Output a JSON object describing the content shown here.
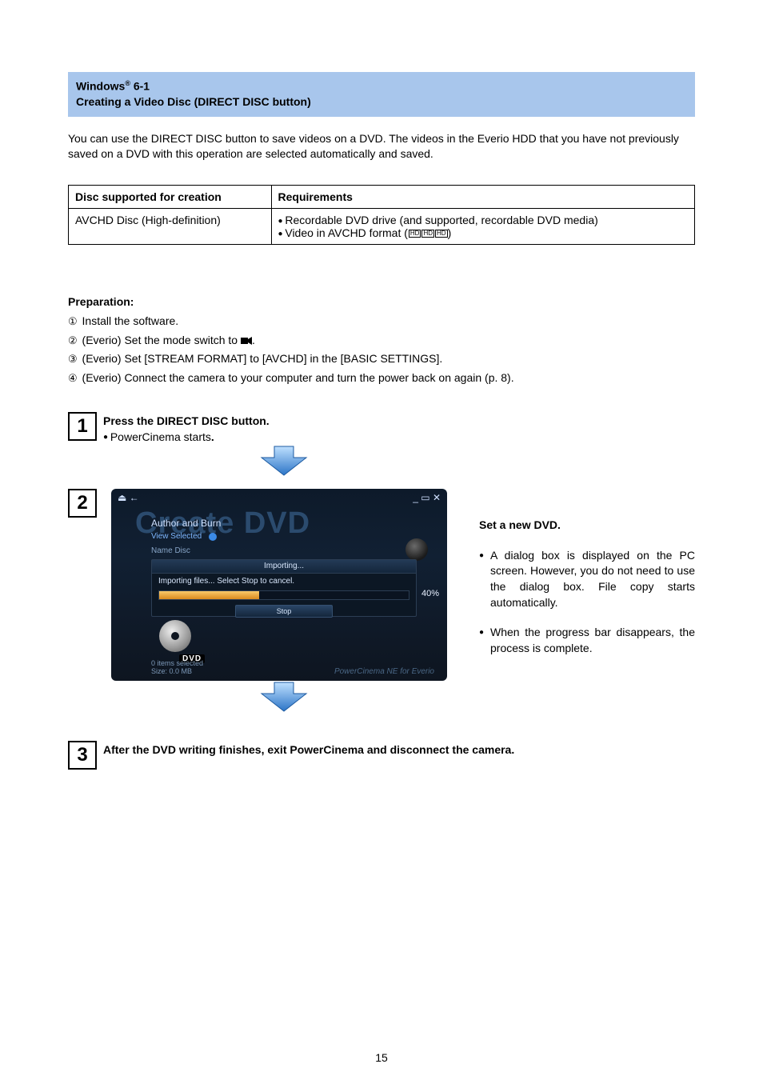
{
  "header": {
    "title_line1_pre": "Windows",
    "title_line1_reg": "®",
    "title_line1_post": " 6-1",
    "title_line2": "Creating a Video Disc (DIRECT DISC button)"
  },
  "intro": "You can use the DIRECT DISC button to save videos on a DVD. The videos in the Everio HDD that you have not previously saved on a DVD with this operation are selected automatically and saved.",
  "table": {
    "head_col1": "Disc supported for creation",
    "head_col2": "Requirements",
    "row_col1": "AVCHD Disc (High-definition)",
    "row_col2_line1": "Recordable DVD drive (and supported, recordable DVD media)",
    "row_col2_line2_pre": "Video in AVCHD format (",
    "row_col2_line2_post": ")"
  },
  "prep": {
    "title": "Preparation:",
    "items": [
      "Install the software.",
      "(Everio) Set the mode switch to ",
      "(Everio) Set [STREAM FORMAT] to [AVCHD] in the [BASIC SETTINGS].",
      "(Everio) Connect the camera to your computer and turn the power back on again (p. 8)."
    ],
    "circled": [
      "①",
      "②",
      "③",
      "④"
    ]
  },
  "step1": {
    "num": "1",
    "title": "Press the DIRECT DISC button.",
    "note": "PowerCinema starts"
  },
  "step2": {
    "num": "2",
    "screenshot": {
      "window_left_icons": "⏏  ←",
      "window_right_icons": "_ ▭ ✕",
      "big_text": "Create DVD",
      "subtitle": "Author and Burn",
      "view_selected": "View Selected",
      "name_disc": "Name Disc",
      "modal_title": "Importing...",
      "modal_body": "Importing files... Select Stop to cancel.",
      "progress_pct": "40%",
      "stop_btn": "Stop",
      "dvd_label": "DVD",
      "footer_line1": "0 items selected",
      "footer_line2": "Size: 0.0 MB",
      "brand": "PowerCinema NE for Everio"
    },
    "right": {
      "heading": "Set a new DVD.",
      "bullet1": "A dialog box is displayed on the PC screen. However, you do not need to use the dialog box. File copy starts automatically.",
      "bullet2": "When the progress bar disappears, the process is complete."
    }
  },
  "step3": {
    "num": "3",
    "text": "After the DVD writing finishes, exit PowerCinema and disconnect the camera."
  },
  "page_number": "15",
  "chart_data": {
    "type": "table",
    "title": "Disc supported for creation / Requirements",
    "columns": [
      "Disc supported for creation",
      "Requirements"
    ],
    "rows": [
      [
        "AVCHD Disc (High-definition)",
        "Recordable DVD drive (and supported, recordable DVD media); Video in AVCHD format (HD icons)"
      ]
    ]
  }
}
